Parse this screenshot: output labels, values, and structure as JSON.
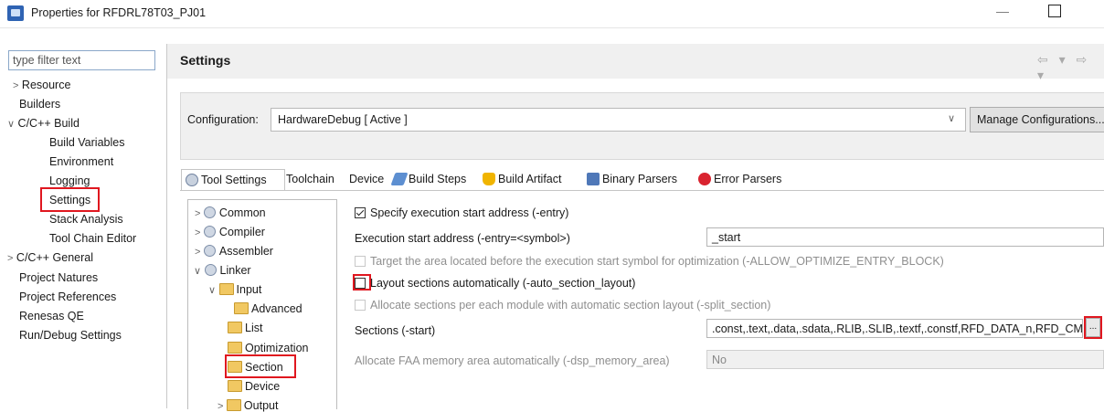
{
  "window": {
    "title": "Properties for RFDRL78T03_PJ01",
    "minimize": "—"
  },
  "filter": {
    "placeholder": "type filter text"
  },
  "left_tree": [
    {
      "label": "Resource",
      "twisty": ">"
    },
    {
      "label": "Builders"
    },
    {
      "label": "C/C++ Build",
      "twisty": "∨"
    },
    {
      "label": "Build Variables"
    },
    {
      "label": "Environment"
    },
    {
      "label": "Logging"
    },
    {
      "label": "Settings",
      "highlighted": true
    },
    {
      "label": "Stack Analysis"
    },
    {
      "label": "Tool Chain Editor"
    },
    {
      "label": "C/C++ General",
      "twisty": ">"
    },
    {
      "label": "Project Natures"
    },
    {
      "label": "Project References"
    },
    {
      "label": "Renesas QE"
    },
    {
      "label": "Run/Debug Settings"
    }
  ],
  "header": {
    "title": "Settings",
    "nav": "⇦ ▾ ⇨ ▾"
  },
  "config": {
    "label": "Configuration:",
    "value": "HardwareDebug  [ Active ]",
    "caret": "∨",
    "manage": "Manage Configurations..."
  },
  "tabs": [
    {
      "label": "Tool Settings",
      "icon": "gear-icon",
      "active": true
    },
    {
      "label": "Toolchain"
    },
    {
      "label": "Device"
    },
    {
      "label": "Build Steps",
      "icon": "build-steps-icon"
    },
    {
      "label": "Build Artifact",
      "icon": "trophy-icon"
    },
    {
      "label": "Binary Parsers",
      "icon": "binary-icon"
    },
    {
      "label": "Error Parsers",
      "icon": "error-icon"
    }
  ],
  "tool_tree": [
    {
      "label": "Common",
      "twisty": ">"
    },
    {
      "label": "Compiler",
      "twisty": ">"
    },
    {
      "label": "Assembler",
      "twisty": ">"
    },
    {
      "label": "Linker",
      "twisty": "∨"
    },
    {
      "label": "Input",
      "twisty": "∨"
    },
    {
      "label": "Advanced"
    },
    {
      "label": "List"
    },
    {
      "label": "Optimization"
    },
    {
      "label": "Section",
      "highlighted": true
    },
    {
      "label": "Device"
    },
    {
      "label": "Output",
      "twisty": ">"
    }
  ],
  "options": {
    "entry_checkbox": "Specify execution start address (-entry)",
    "entry_label": "Execution start address (-entry=<symbol>)",
    "entry_value": "_start",
    "optimize_entry": "Target the area located before the execution start symbol for optimization (-ALLOW_OPTIMIZE_ENTRY_BLOCK)",
    "auto_layout": "Layout sections automatically (-auto_section_layout)",
    "split_section": "Allocate sections per each module with automatic section layout (-split_section)",
    "sections_label": "Sections (-start)",
    "sections_value": ".const,.text,.data,.sdata,.RLIB,.SLIB,.textf,.constf,RFD_DATA_n,RFD_CMD_f,RFD_DATA_f",
    "browse": "...",
    "faa_label": "Allocate FAA memory area automatically (-dsp_memory_area)",
    "faa_value": "No"
  }
}
